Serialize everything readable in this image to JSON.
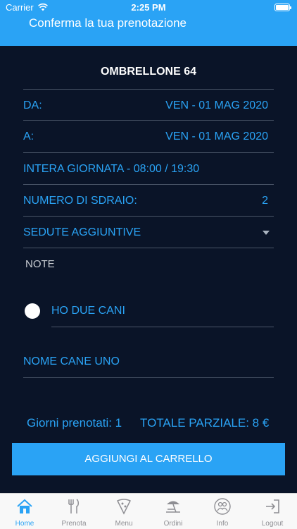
{
  "status": {
    "carrier": "Carrier",
    "time": "2:25 PM"
  },
  "header": {
    "title": "Conferma la tua prenotazione"
  },
  "booking": {
    "umbrella": "OMBRELLONE 64",
    "from_label": "DA:",
    "from_value": "VEN - 01 MAG 2020",
    "to_label": "A:",
    "to_value": "VEN - 01 MAG 2020",
    "slot": "INTERA GIORNATA - 08:00 / 19:30",
    "loungers_label": "NUMERO DI SDRAIO:",
    "loungers_value": "2",
    "extra_seats": "SEDUTE AGGIUNTIVE",
    "note_placeholder": "NOTE",
    "two_dogs": "HO DUE CANI",
    "dog_name_placeholder": "NOME CANE UNO"
  },
  "summary": {
    "days": "Giorni prenotati: 1",
    "total": "TOTALE PARZIALE: 8 €"
  },
  "cart_button": "AGGIUNGI AL CARRELLO",
  "tabs": [
    {
      "label": "Home",
      "icon": "home-icon",
      "active": true
    },
    {
      "label": "Prenota",
      "icon": "cutlery-icon",
      "active": false
    },
    {
      "label": "Menu",
      "icon": "pizza-icon",
      "active": false
    },
    {
      "label": "Ordini",
      "icon": "beach-umbrella-icon",
      "active": false
    },
    {
      "label": "Info",
      "icon": "people-icon",
      "active": false
    },
    {
      "label": "Logout",
      "icon": "logout-icon",
      "active": false
    }
  ],
  "colors": {
    "accent": "#2aa3f5",
    "background": "#0a1428",
    "divider": "#4a5568"
  }
}
